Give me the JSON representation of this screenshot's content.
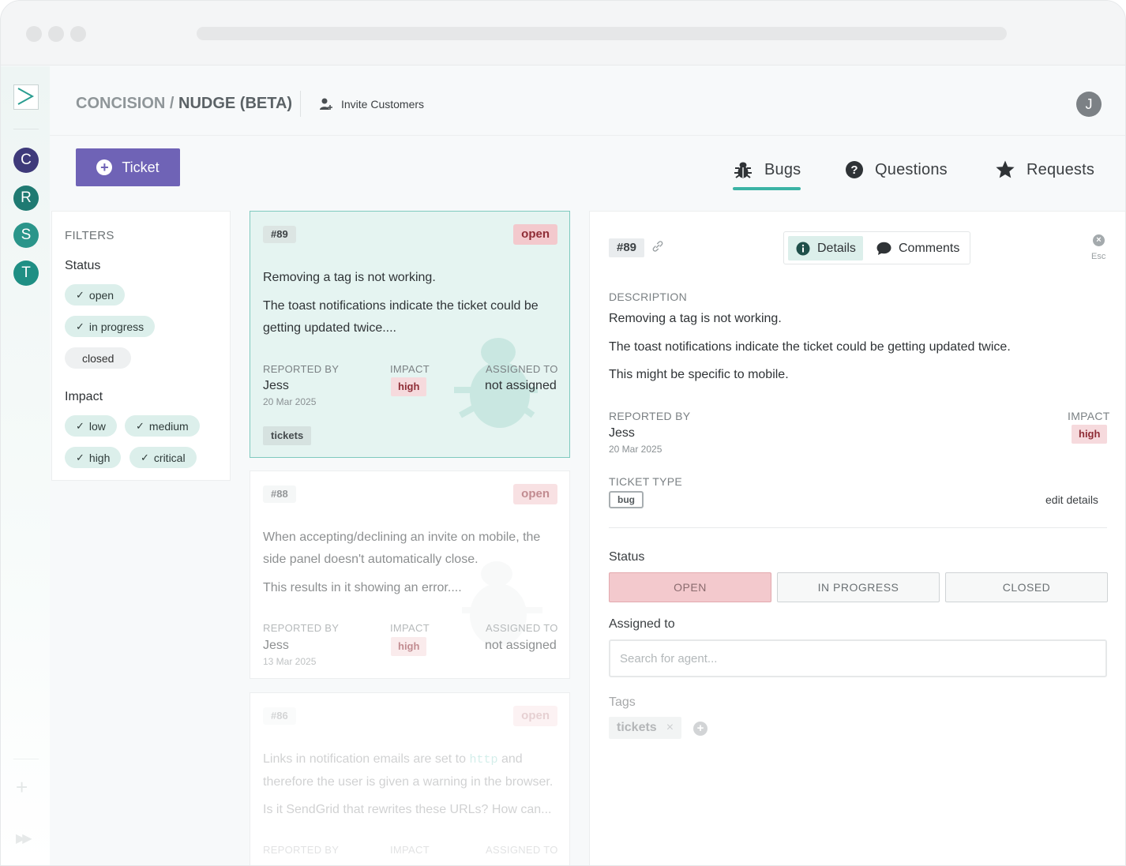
{
  "workspaces": [
    "C",
    "R",
    "S",
    "T"
  ],
  "workspace_colors": [
    "#3e3a7a",
    "#1f7a72",
    "#2a958a",
    "#1f8f84"
  ],
  "header": {
    "breadcrumb_org": "CONCISION /",
    "breadcrumb_project": "NUDGE (BETA)",
    "invite_label": "Invite Customers",
    "avatar_initial": "J"
  },
  "toolbar": {
    "new_ticket_label": "Ticket",
    "tabs": [
      {
        "label": "Bugs",
        "icon": "bug-icon",
        "active": true
      },
      {
        "label": "Questions",
        "icon": "question-circle-icon",
        "active": false
      },
      {
        "label": "Requests",
        "icon": "star-icon",
        "active": false
      }
    ]
  },
  "filters": {
    "title": "FILTERS",
    "status_label": "Status",
    "status_options": [
      {
        "label": "open",
        "checked": true
      },
      {
        "label": "in progress",
        "checked": true
      },
      {
        "label": "closed",
        "checked": false
      }
    ],
    "impact_label": "Impact",
    "impact_options": [
      {
        "label": "low",
        "checked": true
      },
      {
        "label": "medium",
        "checked": true
      },
      {
        "label": "high",
        "checked": true
      },
      {
        "label": "critical",
        "checked": true
      }
    ]
  },
  "tickets": [
    {
      "id": "#89",
      "status": "open",
      "title": "Removing a tag is not working.",
      "body": "The toast notifications indicate the ticket could be getting updated twice....",
      "reported_by_label": "REPORTED BY",
      "reporter": "Jess",
      "date": "20 Mar 2025",
      "impact_label": "IMPACT",
      "impact": "high",
      "assigned_label": "ASSIGNED TO",
      "assignee": "not assigned",
      "tag": "tickets"
    },
    {
      "id": "#88",
      "status": "open",
      "title": "When accepting/declining an invite on mobile, the side panel doesn't automatically close.",
      "body": "This results in it showing an error....",
      "reported_by_label": "REPORTED BY",
      "reporter": "Jess",
      "date": "13 Mar 2025",
      "impact_label": "IMPACT",
      "impact": "high",
      "assigned_label": "ASSIGNED TO",
      "assignee": "not assigned"
    },
    {
      "id": "#86",
      "status": "open",
      "title_before": "Links in notification emails are set to",
      "title_code": "http",
      "title_after": "and therefore the user is given a warning in the browser.",
      "body": "Is it SendGrid that rewrites these URLs? How can...",
      "reported_by_label": "REPORTED BY",
      "impact_label": "IMPACT",
      "assigned_label": "ASSIGNED TO"
    }
  ],
  "detail": {
    "id": "#89",
    "tab_details": "Details",
    "tab_comments": "Comments",
    "esc_label": "Esc",
    "description_label": "DESCRIPTION",
    "description_lines": [
      "Removing a tag is not working.",
      "The toast notifications indicate the ticket could be getting updated twice.",
      "This might be specific to mobile."
    ],
    "reported_by_label": "REPORTED BY",
    "reporter": "Jess",
    "date": "20 Mar 2025",
    "impact_label": "IMPACT",
    "impact": "high",
    "ticket_type_label": "TICKET TYPE",
    "ticket_type": "bug",
    "edit_label": "edit details",
    "status_label": "Status",
    "status_buttons": [
      {
        "label": "OPEN",
        "active": true
      },
      {
        "label": "IN PROGRESS",
        "active": false
      },
      {
        "label": "CLOSED",
        "active": false
      }
    ],
    "assigned_label": "Assigned to",
    "assign_placeholder": "Search for agent...",
    "tags_label": "Tags",
    "tags": [
      "tickets"
    ]
  },
  "colors": {
    "accent": "#3bb3a5",
    "primary_button": "#6f63b6",
    "open_badge": "#f3c9cd",
    "selected_card": "#e5f4f1"
  }
}
